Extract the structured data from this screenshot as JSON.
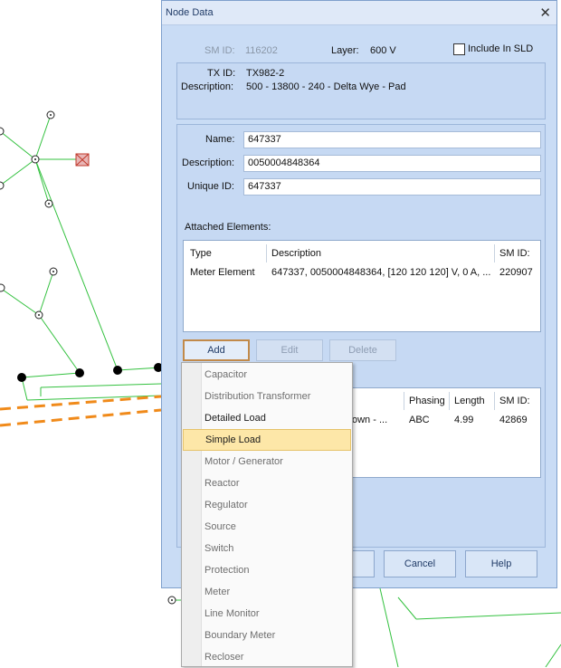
{
  "dialog": {
    "title": "Node Data",
    "close_glyph": "✕",
    "sm_id_label": "SM ID:",
    "sm_id_value": "116202",
    "layer_label": "Layer:",
    "layer_value": "600 V",
    "include_sld_label": "Include In SLD",
    "include_sld_checked": false,
    "tx_id_label": "TX ID:",
    "tx_id_value": "TX982-2",
    "description_label": "Description:",
    "tx_description_value": "500 - 13800 - 240 - Delta Wye - Pad",
    "name_label": "Name:",
    "name_value": "647337",
    "desc_field_label": "Description:",
    "desc_field_value": "0050004848364",
    "unique_id_label": "Unique ID:",
    "unique_id_value": "647337",
    "attached_label": "Attached Elements:",
    "attached_columns": [
      "Type",
      "Description",
      "SM ID:"
    ],
    "attached_rows": [
      {
        "type": "Meter Element",
        "description": "647337, 0050004848364, [120 120 120] V, 0 A, ...",
        "sm_id": "220907"
      }
    ],
    "buttons": {
      "add": "Add",
      "edit": "Edit",
      "delete": "Delete",
      "cancel": "Cancel",
      "help": "Help"
    },
    "lines_columns": [
      "Phasing",
      "Length",
      "SM ID:"
    ],
    "lines_rows": [
      {
        "description": "own - ...",
        "phasing": "ABC",
        "length": "4.99",
        "sm_id": "42869"
      }
    ]
  },
  "add_menu": {
    "items": [
      {
        "label": "Capacitor",
        "enabled": false
      },
      {
        "label": "Distribution Transformer",
        "enabled": false
      },
      {
        "label": "Detailed Load",
        "enabled": true
      },
      {
        "label": "Simple Load",
        "enabled": true,
        "highlighted": true
      },
      {
        "label": "Motor / Generator",
        "enabled": false
      },
      {
        "label": "Reactor",
        "enabled": false
      },
      {
        "label": "Regulator",
        "enabled": false
      },
      {
        "label": "Source",
        "enabled": false
      },
      {
        "label": "Switch",
        "enabled": false
      },
      {
        "label": "Protection",
        "enabled": false
      },
      {
        "label": "Meter",
        "enabled": false
      },
      {
        "label": "Line Monitor",
        "enabled": false
      },
      {
        "label": "Boundary Meter",
        "enabled": false
      },
      {
        "label": "Recloser",
        "enabled": false
      }
    ]
  },
  "colors": {
    "line": "#33c13f",
    "dashed": "#f08a1a",
    "dialog_bg": "#c9dcf5",
    "highlight": "#fde7a8"
  }
}
